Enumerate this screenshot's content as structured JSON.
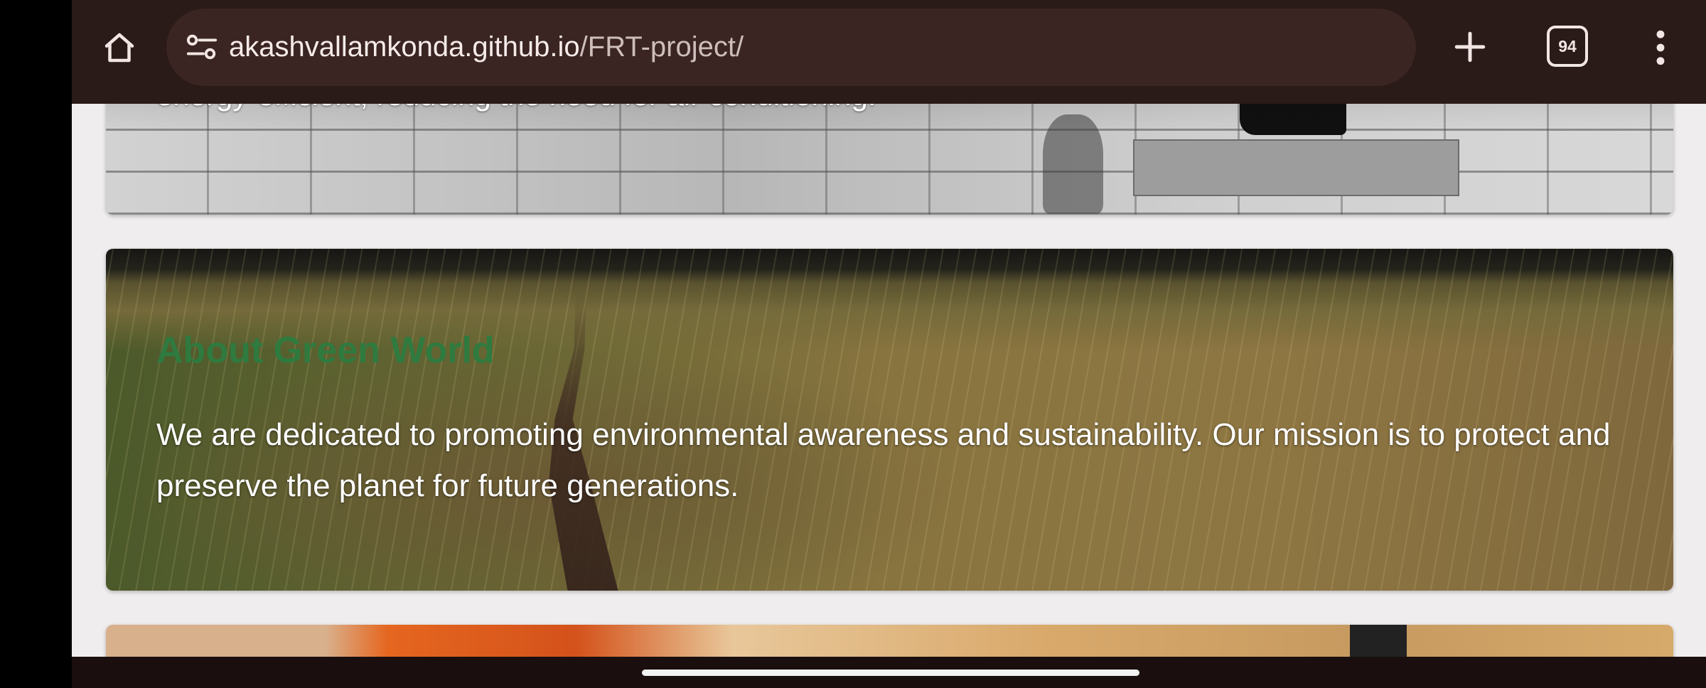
{
  "browser": {
    "url_host": "akashvallamkonda.github.io",
    "url_path": "/FRT-project/",
    "tab_count": "94",
    "icons": {
      "home": "home-icon",
      "site_info": "site-info-icon",
      "new_tab": "plus-icon",
      "tabs": "tab-switcher-icon",
      "menu": "more-vert-icon"
    }
  },
  "page": {
    "previous_card_text": "energy-efficient, reducing the need for air conditioning.",
    "about": {
      "title": "About Green World",
      "text": "We are dedicated to promoting environmental awareness and sustainability. Our mission is to protect and preserve the planet for future generations."
    }
  },
  "colors": {
    "toolbar": "#2a1a18",
    "omnibox": "#3a2522",
    "page_bg": "#efeded",
    "heading_green": "#2f7a3f"
  }
}
